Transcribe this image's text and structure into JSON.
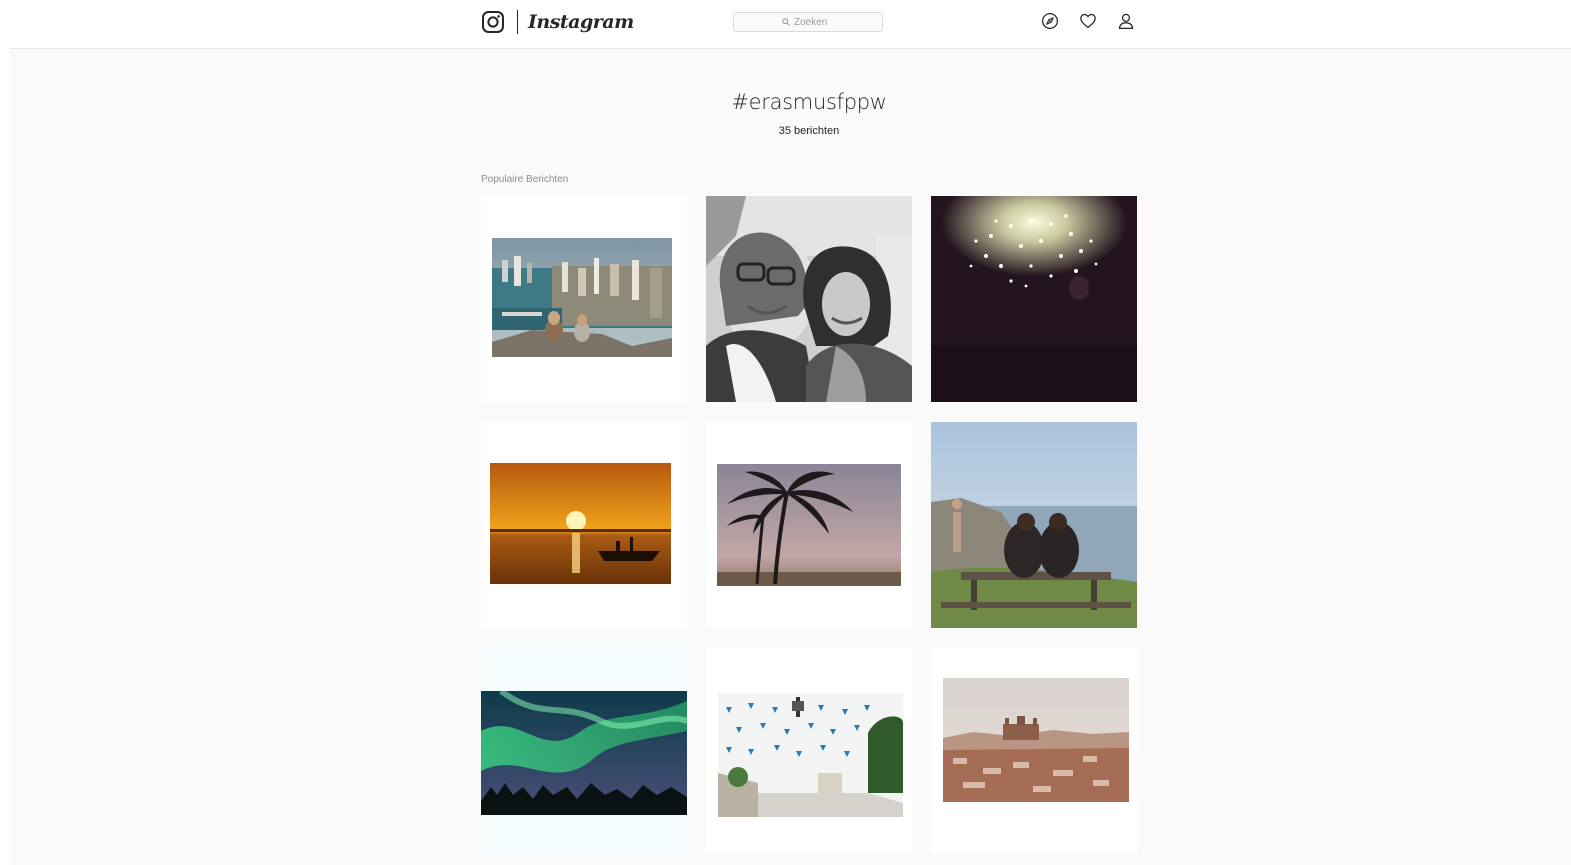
{
  "header": {
    "wordmark": "Instagram",
    "search_placeholder": "Zoeken"
  },
  "hashtag": {
    "title": "#erasmusfppw",
    "post_count": "35 berichten"
  },
  "sections": {
    "popular_label": "Populaire Berichten"
  },
  "icons": {
    "logo": "instagram-camera-icon",
    "search": "search-icon",
    "explore": "compass-icon",
    "activity": "heart-icon",
    "profile": "person-icon"
  },
  "colors": {
    "page_background": "#fafafa",
    "header_background": "#ffffff",
    "border": "#e6e6e6",
    "text": "#262626",
    "muted_text": "#8e8e8e"
  }
}
